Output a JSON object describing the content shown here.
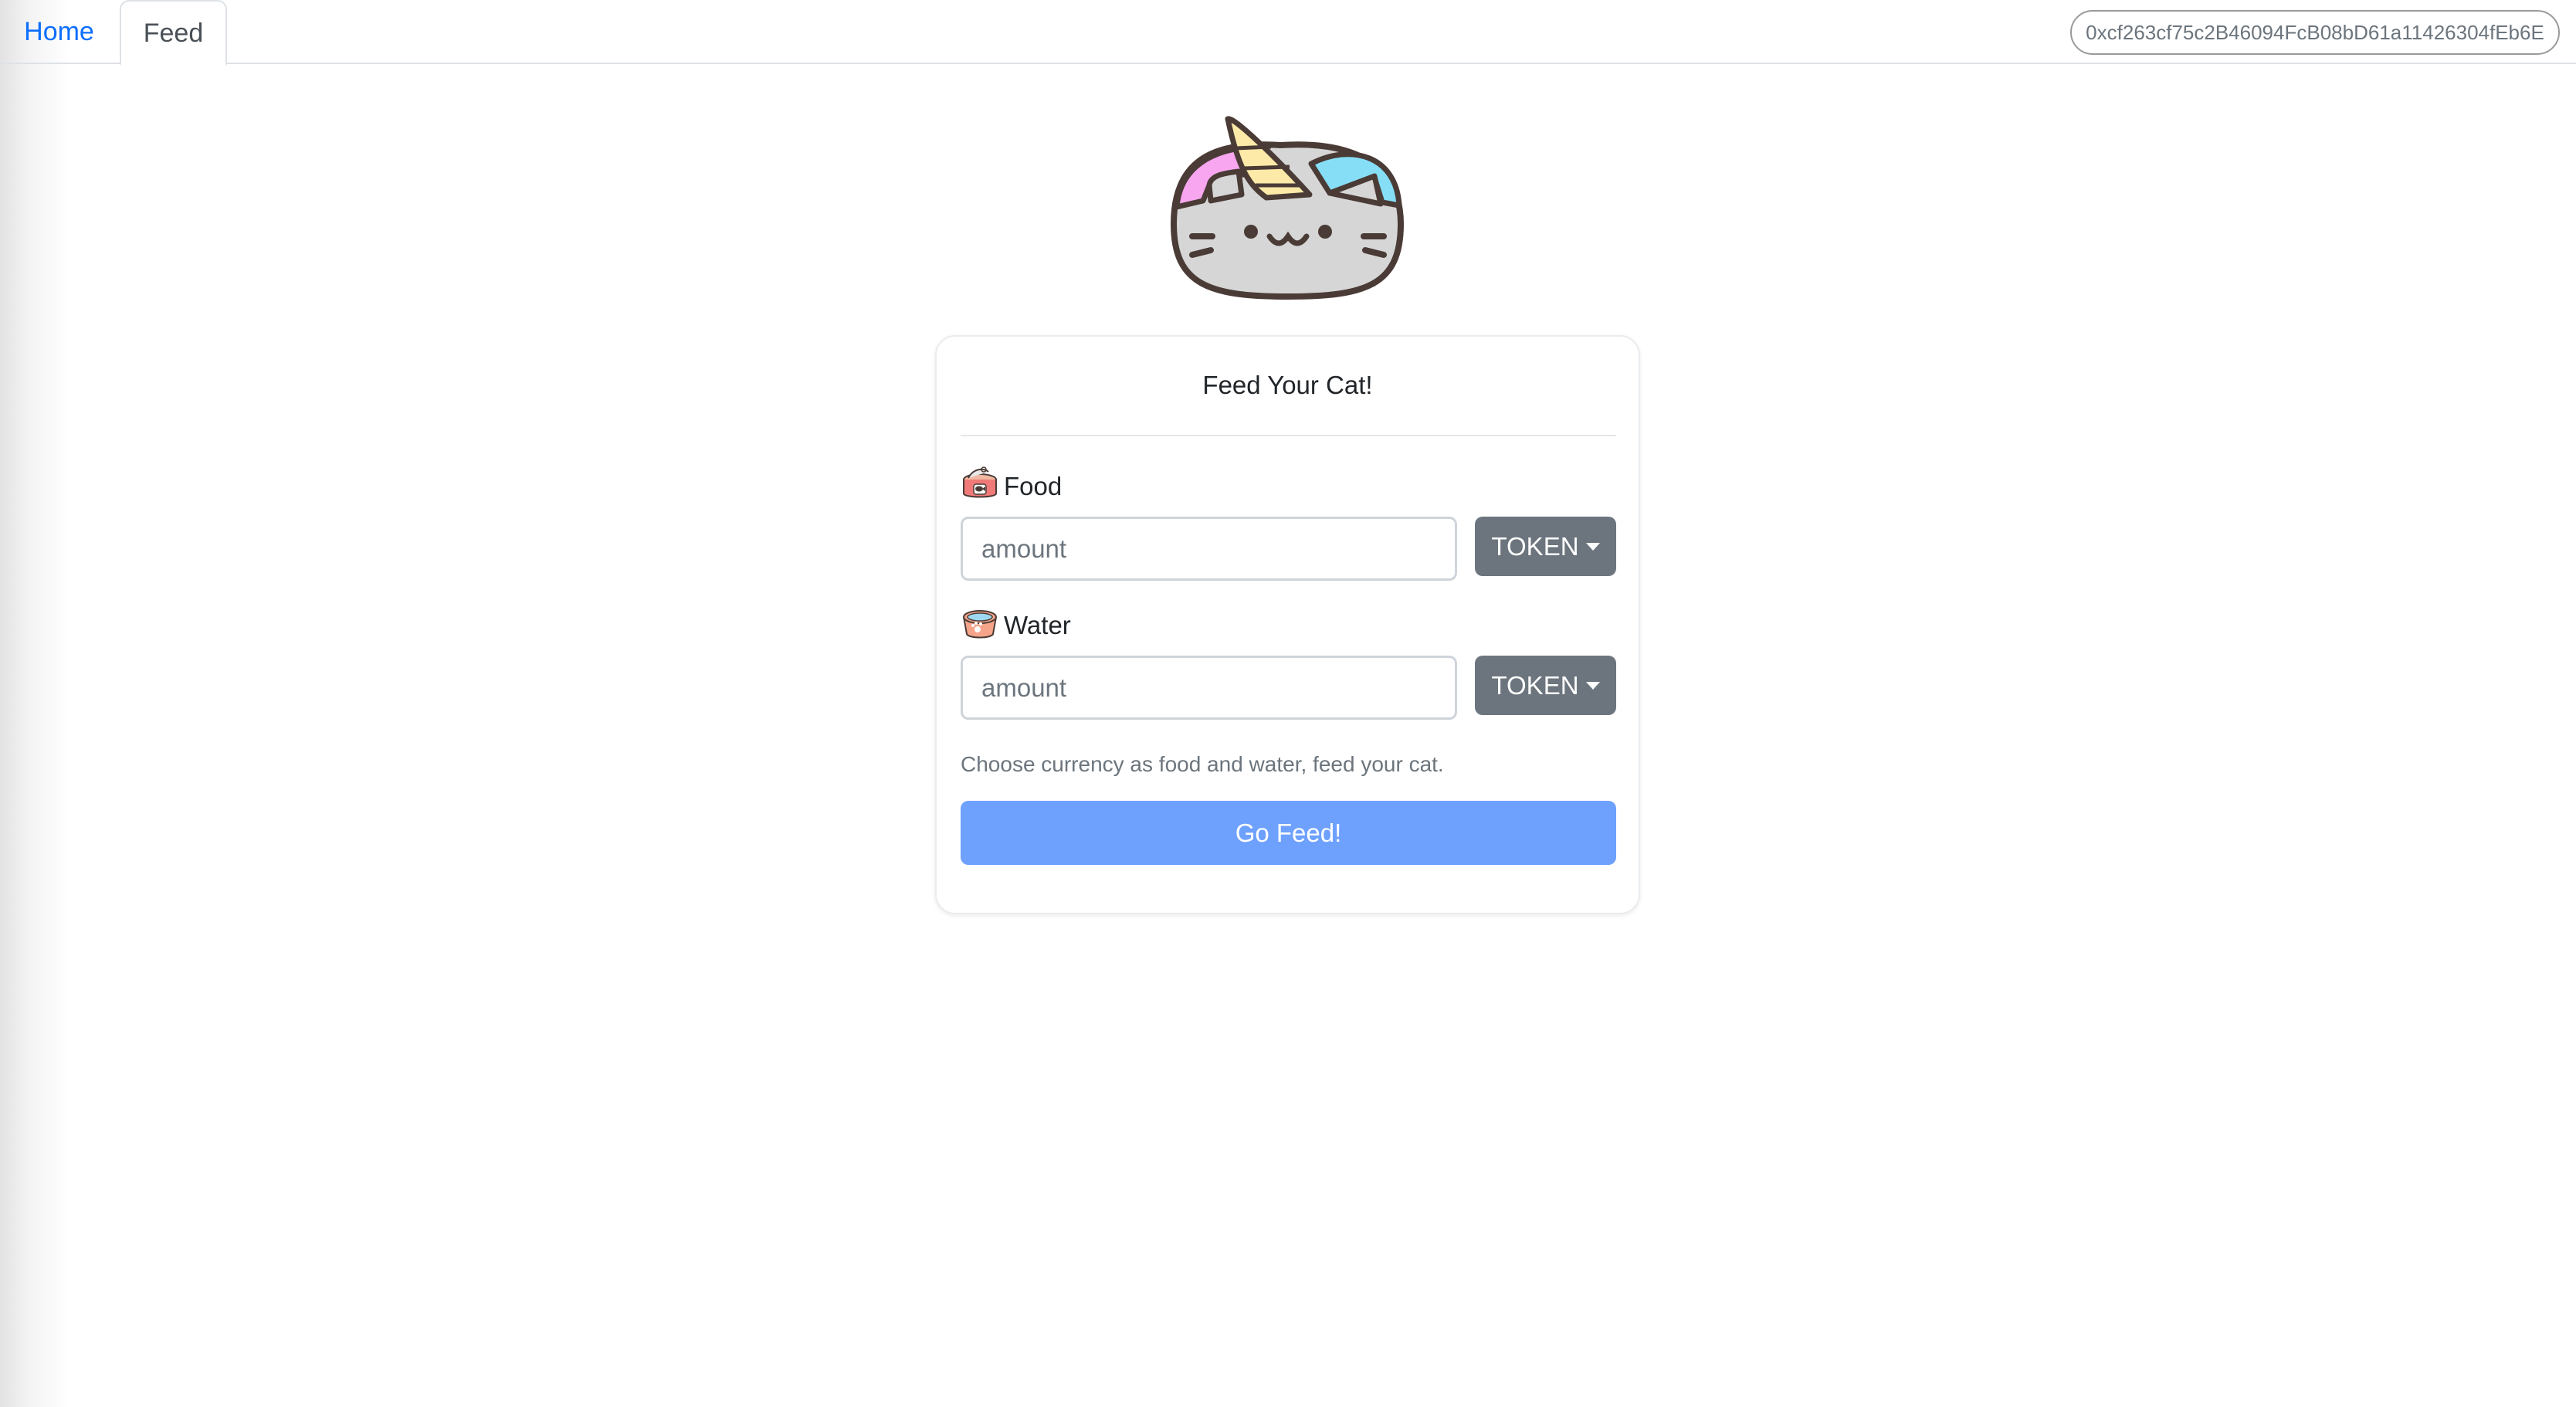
{
  "nav": {
    "tabs": [
      {
        "label": "Home",
        "active": false
      },
      {
        "label": "Feed",
        "active": true
      }
    ],
    "wallet_address": "0xcf263cf75c2B46094FcB08bD61a11426304fEb6E"
  },
  "logo": {
    "icon": "unicorn-cat-icon"
  },
  "card": {
    "title": "Feed Your Cat!",
    "food": {
      "icon": "cat-food-can-icon",
      "label": "Food",
      "input_value": "",
      "input_placeholder": "amount",
      "token_label": "TOKEN"
    },
    "water": {
      "icon": "water-bowl-icon",
      "label": "Water",
      "input_value": "",
      "input_placeholder": "amount",
      "token_label": "TOKEN"
    },
    "help_text": "Choose currency as food and water, feed your cat.",
    "submit_label": "Go Feed!"
  },
  "colors": {
    "link": "#0d6efd",
    "secondary": "#6c757d",
    "primary_disabled": "#6ea1fe"
  }
}
